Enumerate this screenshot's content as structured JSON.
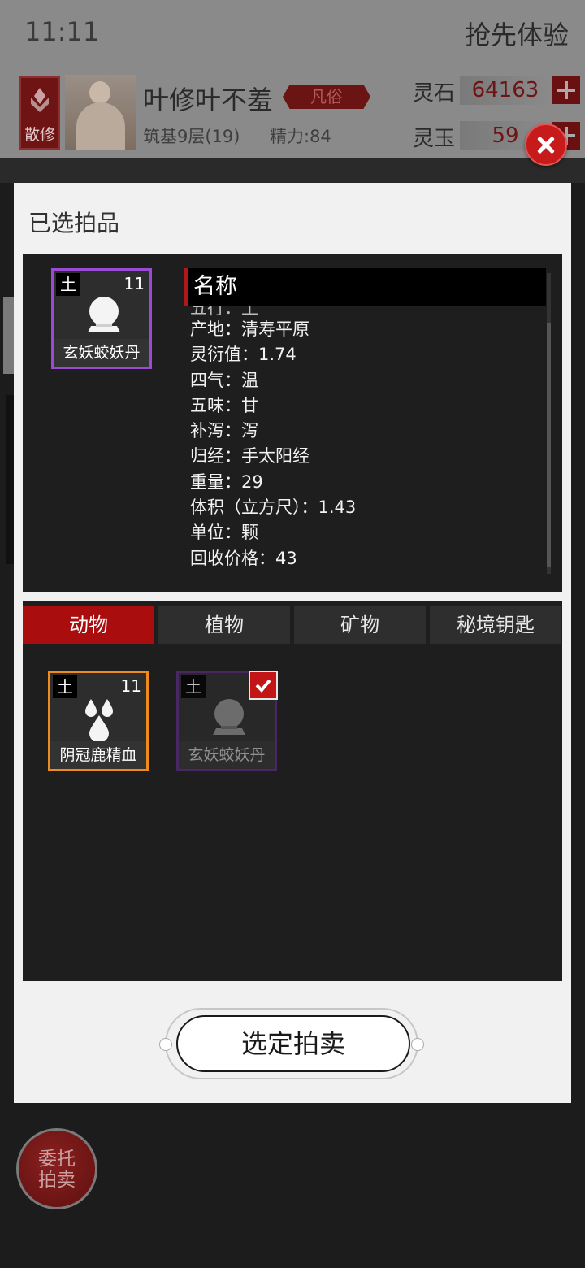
{
  "status_bar": {
    "time": "11:11",
    "right_label": "抢先体验"
  },
  "player": {
    "sect_label": "散修",
    "name": "叶修叶不羞",
    "rank_badge": "凡俗",
    "cultivation": "筑基9层(19)",
    "energy": "精力:84"
  },
  "resources": [
    {
      "label": "灵石",
      "value": "64163"
    },
    {
      "label": "灵玉",
      "value": "59"
    }
  ],
  "dialog": {
    "title": "已选拍品",
    "detail": {
      "item": {
        "element": "土",
        "quantity": "11",
        "name": "玄妖蛟妖丹",
        "icon": "orb-icon"
      },
      "header": "名称",
      "partial_line": "五行：土",
      "lines": [
        "产地：清寿平原",
        "灵衍值：1.74",
        "四气：温",
        "五味：甘",
        "补泻：泻",
        "归经：手太阳经",
        "重量：29",
        "体积（立方尺）：1.43",
        "单位：颗",
        "回收价格：43"
      ]
    },
    "tabs": [
      "动物",
      "植物",
      "矿物",
      "秘境钥匙"
    ],
    "active_tab": "动物",
    "inventory": [
      {
        "element": "土",
        "quantity": "11",
        "name": "阴冠鹿精血",
        "icon": "blood-drops-icon",
        "border_color": "#ef8a1c",
        "selected": false
      },
      {
        "element": "土",
        "name": "玄妖蛟妖丹",
        "icon": "orb-icon",
        "border_color": "#5a2a80",
        "selected": true
      }
    ],
    "confirm_label": "选定拍卖"
  },
  "entrust_button": {
    "line1": "委托",
    "line2": "拍卖"
  },
  "colors": {
    "accent_red": "#a90d0d",
    "rare_purple": "#9b4ad6",
    "uncommon_orange": "#ef8a1c"
  }
}
